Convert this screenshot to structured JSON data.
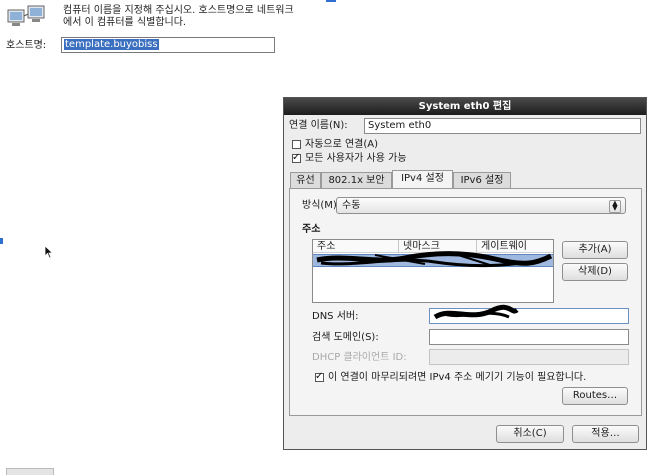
{
  "installer": {
    "info_line1": "컴퓨터 이름을 지정해 주십시오. 호스트명으로 네트워크",
    "info_line2": "에서 이 컴퓨터를 식별합니다.",
    "hostname_label": "호스트명:",
    "hostname_value": "template.buyobiss"
  },
  "dialog": {
    "title": "System eth0 편집",
    "connection_name_label": "연결 이름(N):",
    "connection_name_value": "System eth0",
    "auto_connect_label": "자동으로 연결(A)",
    "auto_connect_checked": false,
    "all_users_label": "모든 사용자가 사용 가능",
    "all_users_checked": true,
    "tabs": [
      {
        "label": "유선",
        "active": false
      },
      {
        "label": "802.1x 보안",
        "active": false
      },
      {
        "label": "IPv4 설정",
        "active": true
      },
      {
        "label": "IPv6 설정",
        "active": false
      }
    ],
    "ipv4": {
      "method_label": "방식(M):",
      "method_value": "수동",
      "address_section_label": "주소",
      "columns": [
        "주소",
        "넷마스크",
        "게이트웨이"
      ],
      "add_button": "추가(A)",
      "delete_button": "삭제(D)",
      "dns_label": "DNS 서버:",
      "search_domain_label": "검색 도메인(S):",
      "dhcp_client_id_label": "DHCP 클라이언트 ID:",
      "require_ipv4_label": "이 연결이 마무리되려면 IPv4 주소 메기기 기능이 필요합니다.",
      "require_ipv4_checked": true,
      "routes_button": "Routes…"
    },
    "cancel_button": "취소(C)",
    "apply_button": "적용…"
  }
}
